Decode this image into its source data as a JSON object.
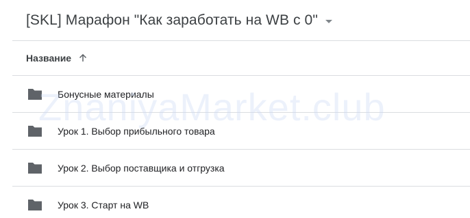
{
  "header": {
    "title": "[SKL] Марафон \"Как заработать на WB с 0\""
  },
  "list": {
    "column_name": "Название",
    "sort_icon": "arrow-up-icon",
    "items": [
      {
        "label": "Бонусные материалы",
        "icon": "folder-icon"
      },
      {
        "label": "Урок 1. Выбор прибыльного товара",
        "icon": "folder-icon"
      },
      {
        "label": "Урок 2. Выбор поставщика и отгрузка",
        "icon": "folder-icon"
      },
      {
        "label": "Урок 3. Старт на WB",
        "icon": "folder-icon"
      }
    ]
  },
  "watermark": "ZnaniyaMarket.club",
  "colors": {
    "divider": "#dadce0",
    "folder": "#5f6368",
    "text": "#202124",
    "watermark": "#c9d9f5"
  }
}
